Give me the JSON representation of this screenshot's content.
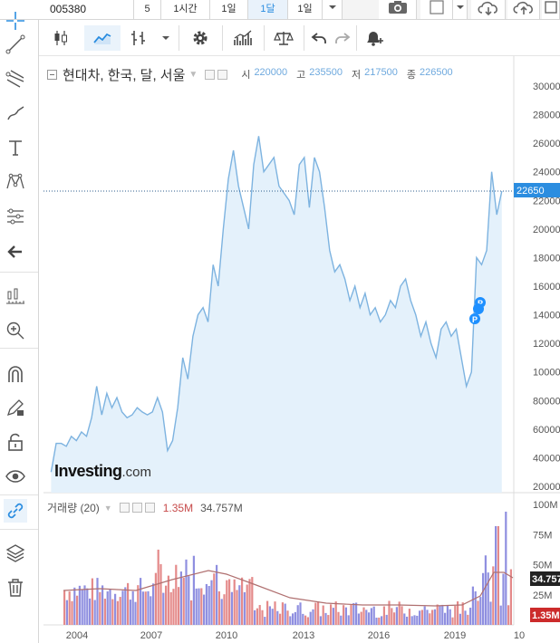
{
  "toolbar": {
    "symbol": "005380",
    "tf_5": "5",
    "tf_1h": "1시간",
    "tf_1d": "1일",
    "tf_1m": "1달",
    "tf_selected": "1일"
  },
  "legend": {
    "title": "현대차, 한국, 달, 서울",
    "open_label": "시",
    "open": "220000",
    "high_label": "고",
    "high": "235500",
    "low_label": "저",
    "low": "217500",
    "close_label": "종",
    "close": "226500"
  },
  "volume_legend": {
    "title": "거래량 (20)",
    "current": "1.35M",
    "ma": "34.757M"
  },
  "brand": {
    "name": "Investing",
    "suffix": ".com"
  },
  "price_badge": "22650",
  "vol_badge_ma": "34.757",
  "vol_badge_cur": "1.35M",
  "colors": {
    "line": "#7db3e0",
    "area": "#e4f1fb",
    "accent": "#2b8de0",
    "vol_up": "#e48a8a",
    "vol_down": "#8f8fe0",
    "badge_red": "#cc2b2b",
    "badge_black": "#222222"
  },
  "chart_data": [
    {
      "type": "area",
      "title": "",
      "y_ticks": [
        "30000",
        "28000",
        "26000",
        "24000",
        "22000",
        "20000",
        "18000",
        "16000",
        "14000",
        "12000",
        "10000",
        "80000",
        "60000",
        "40000",
        "20000"
      ],
      "x_ticks": [
        "2004",
        "2007",
        "2010",
        "2013",
        "2016",
        "2019",
        "10"
      ],
      "ylim": [
        20000,
        300000
      ],
      "last_value": 226500,
      "series": [
        {
          "x": [
            2003.7,
            2003.9,
            2004.1,
            2004.3,
            2004.5,
            2004.7,
            2004.9,
            2005.1,
            2005.3,
            2005.5,
            2005.7,
            2005.9,
            2006.1,
            2006.3,
            2006.5,
            2006.7,
            2006.9,
            2007.1,
            2007.3,
            2007.5,
            2007.7,
            2007.9,
            2008.1,
            2008.3,
            2008.5,
            2008.7,
            2008.9,
            2009.1,
            2009.3,
            2009.5,
            2009.7,
            2009.9,
            2010.1,
            2010.3,
            2010.5,
            2010.7,
            2010.9,
            2011.1,
            2011.3,
            2011.5,
            2011.7,
            2011.9,
            2012.1,
            2012.3,
            2012.5,
            2012.7,
            2012.9,
            2013.1,
            2013.3,
            2013.5,
            2013.7,
            2013.9,
            2014.1,
            2014.3,
            2014.5,
            2014.7,
            2014.9,
            2015.1,
            2015.3,
            2015.5,
            2015.7,
            2015.9,
            2016.1,
            2016.3,
            2016.5,
            2016.7,
            2016.9,
            2017.1,
            2017.3,
            2017.5,
            2017.7,
            2017.9,
            2018.1,
            2018.3,
            2018.5,
            2018.7,
            2018.9,
            2019.1,
            2019.3,
            2019.5,
            2019.7,
            2019.9,
            2020.1,
            2020.3,
            2020.5,
            2020.7,
            2020.9,
            2021.1,
            2021.3,
            2021.5
          ],
          "y": [
            30000,
            50000,
            50000,
            48000,
            55000,
            52000,
            58000,
            55000,
            68000,
            90000,
            70000,
            85000,
            75000,
            82000,
            72000,
            68000,
            70000,
            75000,
            72000,
            70000,
            72000,
            82000,
            72000,
            45000,
            52000,
            75000,
            110000,
            95000,
            125000,
            140000,
            145000,
            135000,
            175000,
            160000,
            200000,
            235000,
            255000,
            230000,
            215000,
            200000,
            245000,
            265000,
            240000,
            245000,
            250000,
            230000,
            225000,
            220000,
            210000,
            245000,
            250000,
            215000,
            250000,
            240000,
            215000,
            185000,
            170000,
            175000,
            165000,
            150000,
            160000,
            145000,
            155000,
            140000,
            145000,
            135000,
            140000,
            150000,
            145000,
            160000,
            165000,
            150000,
            140000,
            125000,
            135000,
            120000,
            110000,
            130000,
            135000,
            125000,
            130000,
            110000,
            90000,
            100000,
            180000,
            175000,
            185000,
            240000,
            210000,
            226500
          ]
        }
      ]
    },
    {
      "type": "bar",
      "title": "거래량 (20)",
      "y_ticks": [
        "100M",
        "75M",
        "50M",
        "25M"
      ],
      "ylim": [
        0,
        100
      ],
      "current": 1.35,
      "ma": 34.757
    }
  ]
}
